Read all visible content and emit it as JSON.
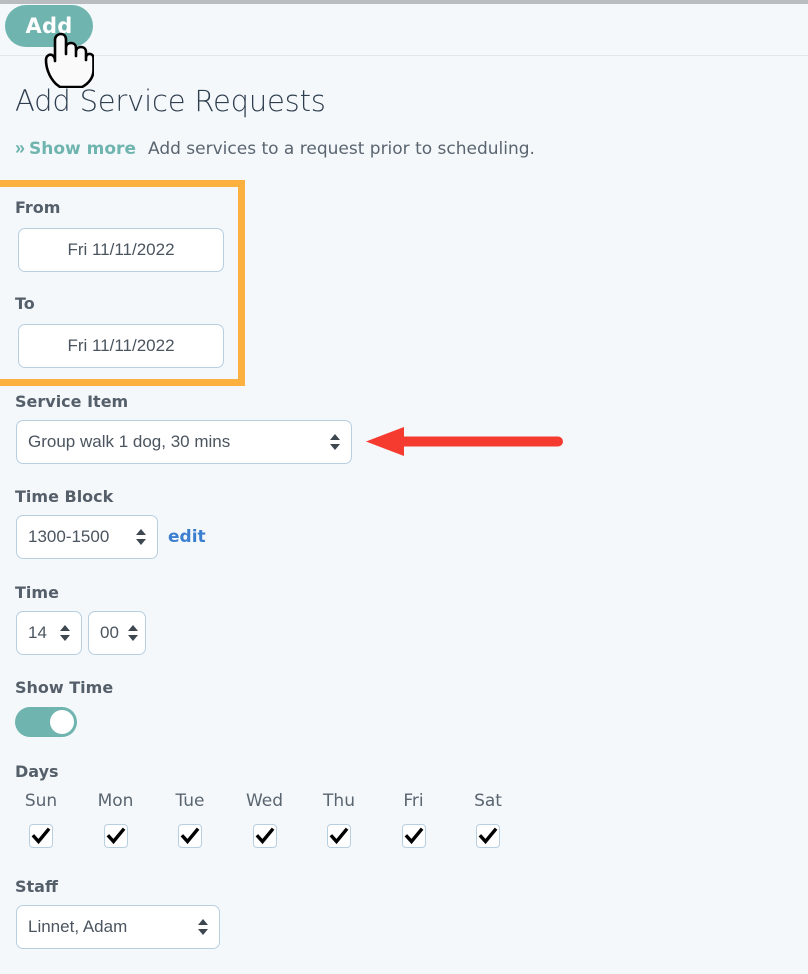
{
  "colors": {
    "accent_teal": "#6fb4af",
    "highlight_orange": "#fbb040",
    "arrow_red": "#f53b30",
    "link_blue": "#3c7fd0",
    "page_background": "#f4f8fb",
    "input_border": "#b8cfe0"
  },
  "toolbar": {
    "add_label": "Add"
  },
  "header": {
    "title": "Add Service Requests",
    "show_more_icon": "double-chevron-right",
    "show_more_label": "Show more",
    "description": "Add services to a request prior to scheduling."
  },
  "form": {
    "from": {
      "label": "From",
      "value": "Fri 11/11/2022",
      "placeholder": "Fri 11/11/2022"
    },
    "to": {
      "label": "To",
      "value": "Fri 11/11/2022",
      "placeholder": "Fri 11/11/2022"
    },
    "service_item": {
      "label": "Service Item",
      "value": "Group walk 1 dog, 30 mins"
    },
    "time_block": {
      "label": "Time Block",
      "value": "1300-1500",
      "edit_label": "edit"
    },
    "time": {
      "label": "Time",
      "hours": "14",
      "minutes": "00"
    },
    "show_time": {
      "label": "Show Time",
      "state": "on"
    },
    "days": {
      "label": "Days",
      "items": [
        {
          "name": "Sun",
          "checked": true
        },
        {
          "name": "Mon",
          "checked": true
        },
        {
          "name": "Tue",
          "checked": true
        },
        {
          "name": "Wed",
          "checked": true
        },
        {
          "name": "Thu",
          "checked": true
        },
        {
          "name": "Fri",
          "checked": true
        },
        {
          "name": "Sat",
          "checked": true
        }
      ]
    },
    "staff": {
      "label": "Staff",
      "value": "Linnet, Adam"
    }
  },
  "annotations": {
    "highlight_target": "from-to-date-fields",
    "arrow_target": "service-item-select"
  }
}
